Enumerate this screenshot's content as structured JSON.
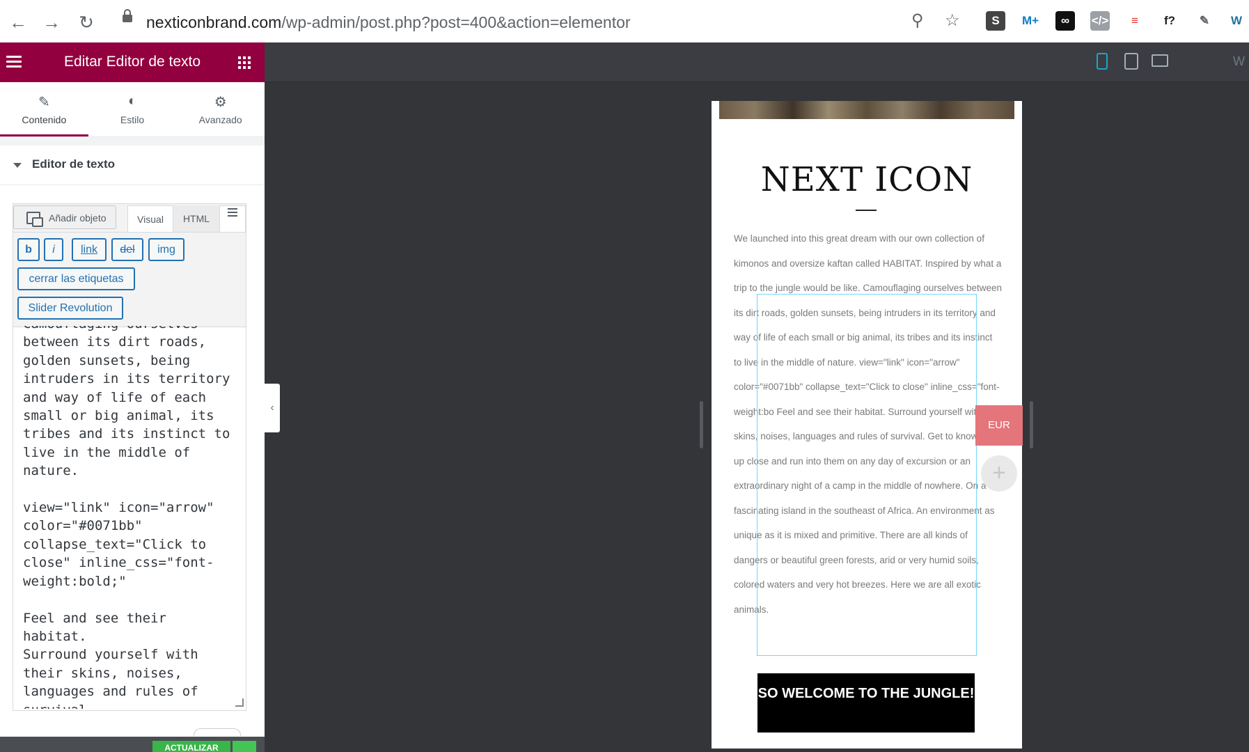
{
  "browser": {
    "url_host": "nexticonbrand.com",
    "url_path": "/wp-admin/post.php?post=400&action=elementor",
    "nav": {
      "back": "←",
      "forward": "→",
      "reload": "↻"
    },
    "omnibox_icons": {
      "zoom": "⚲",
      "star": "☆"
    },
    "extensions": [
      {
        "icon": "s-extension-icon",
        "glyph": "S",
        "bg": "#444444",
        "fg": "#ffffff"
      },
      {
        "icon": "movistar-icon",
        "glyph": "M+",
        "bg": "#ffffff",
        "fg": "#0b7ec3"
      },
      {
        "icon": "infinity-icon",
        "glyph": "∞",
        "bg": "#111111",
        "fg": "#ffffff"
      },
      {
        "icon": "code-icon",
        "glyph": "</>",
        "bg": "#9aa0a6",
        "fg": "#ffffff"
      },
      {
        "icon": "red-circle-icon",
        "glyph": "≡",
        "bg": "#ffffff",
        "fg": "#e53935"
      },
      {
        "icon": "font-icon",
        "glyph": "f?",
        "bg": "#ffffff",
        "fg": "#202124"
      },
      {
        "icon": "eyedropper-icon",
        "glyph": "✎",
        "bg": "#ffffff",
        "fg": "#5f6368"
      },
      {
        "icon": "wordpress-icon",
        "glyph": "W",
        "bg": "#ffffff",
        "fg": "#21759b"
      }
    ]
  },
  "panel": {
    "title": "Editar Editor de texto",
    "tabs": [
      {
        "label": "Contenido",
        "icon": "✎"
      },
      {
        "label": "Estilo",
        "icon": "◐"
      },
      {
        "label": "Avanzado",
        "icon": "⚙"
      }
    ],
    "section_title": "Editor de texto",
    "editor": {
      "add_media": "Añadir objeto",
      "mode_visual": "Visual",
      "mode_html": "HTML",
      "buttons": [
        "b",
        "i",
        "link",
        "del",
        "img",
        "cerrar las etiquetas",
        "Slider Revolution"
      ],
      "content": "Camouflaging ourselves\nbetween its dirt roads,\ngolden sunsets, being\nintruders in its territory\nand way of life of each\nsmall or big animal, its\ntribes and its instinct to\nlive in the middle of\nnature.\n\nview=\"link\" icon=\"arrow\"\ncolor=\"#0071bb\"\ncollapse_text=\"Click to\nclose\" inline_css=\"font-\nweight:bold;\"\n\nFeel and see their habitat.\nSurround yourself with\ntheir skins, noises,\nlanguages and rules of\nsurvival."
    },
    "footer": {
      "update_label": "ACTUALIZAR"
    }
  },
  "preview": {
    "right_letter": "W",
    "brand": "NEXT ICON",
    "body": "We launched into this great dream with our own collection of kimonos and oversize kaftan called HABITAT. Inspired by what a trip to the jungle would be like. Camouflaging ourselves between its dirt roads, golden sunsets, being intruders in its territory and way of life of each small or big animal, its tribes and its instinct to live in the middle of nature. view=\"link\" icon=\"arrow\" color=\"#0071bb\" collapse_text=\"Click to close\" inline_css=\"font-weight:bo Feel and see their habitat. Surround yourself with their skins, noises, languages and rules of survival. Get to know them up close and run into them on any day of excursion or an extraordinary night of a camp in the middle of nowhere. On a fascinating island in the southeast of Africa. An environment as unique as it is mixed and primitive. There are all kinds of dangers or beautiful green forests, arid or very humid soils, colored waters and very hot breezes. Here we are all exotic animals.",
    "cta": "SO WELCOME TO THE JUNGLE!",
    "currency": "EUR",
    "add_glyph": "+"
  },
  "colors": {
    "elementor_maroon": "#93003f",
    "editor_blue": "#2271b1",
    "selection_cyan": "#71d7f7",
    "currency_pink": "#e4757a",
    "update_green": "#39b54a"
  }
}
